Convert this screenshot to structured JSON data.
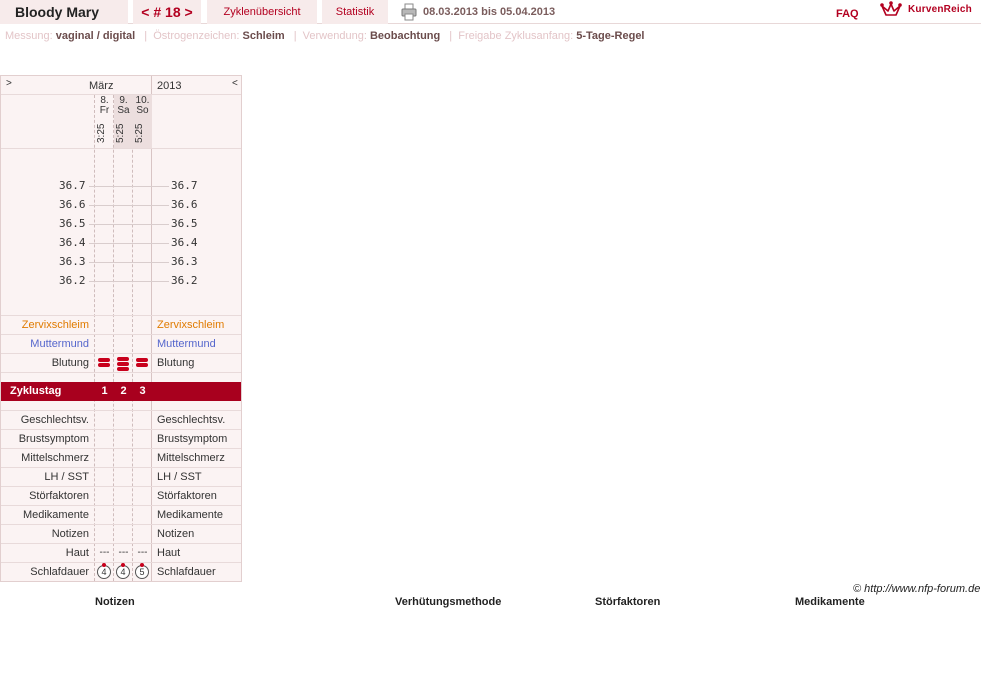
{
  "topbar": {
    "name": "Bloody Mary",
    "cycle": "< # 18 >",
    "overview": "Zyklenübersicht",
    "statistics": "Statistik",
    "date_range": "08.03.2013 bis 05.04.2013",
    "faq": "FAQ",
    "logo": "KurvenReich",
    "accent": "#b30020"
  },
  "settings": {
    "measurement_label": "Messung:",
    "measurement_value": "vaginal / digital",
    "oestrogen_label": "Östrogenzeichen:",
    "oestrogen_value": "Schleim",
    "usage_label": "Verwendung:",
    "usage_value": "Beobachtung",
    "release_label": "Freigabe Zyklusanfang:",
    "release_value": "5-Tage-Regel"
  },
  "chart": {
    "nav_next": ">",
    "nav_prev": "<",
    "month": "März",
    "year": "2013",
    "days": [
      {
        "num": "8.",
        "weekday": "Fr",
        "time": "3:25",
        "cycle_day": "1",
        "blood": 2,
        "skin": "---",
        "sleep": "4"
      },
      {
        "num": "9.",
        "weekday": "Sa",
        "time": "5:25",
        "cycle_day": "2",
        "blood": 3,
        "skin": "---",
        "sleep": "4"
      },
      {
        "num": "10.",
        "weekday": "So",
        "time": "5:25",
        "cycle_day": "3",
        "blood": 2,
        "skin": "---",
        "sleep": "5"
      }
    ],
    "temperatures": [
      "36.7",
      "36.6",
      "36.5",
      "36.4",
      "36.3",
      "36.2"
    ],
    "labels": {
      "cervix_mucus": "Zervixschleim",
      "cervix": "Muttermund",
      "bleeding": "Blutung",
      "cycle_day": "Zyklustag",
      "intercourse": "Geschlechtsv.",
      "breast": "Brustsymptom",
      "mittelschmerz": "Mittelschmerz",
      "lh": "LH / SST",
      "disruptions": "Störfaktoren",
      "medication": "Medikamente",
      "notes": "Notizen",
      "skin": "Haut",
      "sleep": "Schlafdauer"
    },
    "colors": {
      "cervix_mucus": "#e07b00",
      "cervix": "#5566cc",
      "cycle_bar": "#a8001e",
      "blood": "#c8001c"
    }
  },
  "footer": {
    "copyright": "© http://www.nfp-forum.de",
    "notes": "Notizen",
    "method": "Verhütungsmethode",
    "disruptions": "Störfaktoren",
    "medication": "Medikamente"
  }
}
